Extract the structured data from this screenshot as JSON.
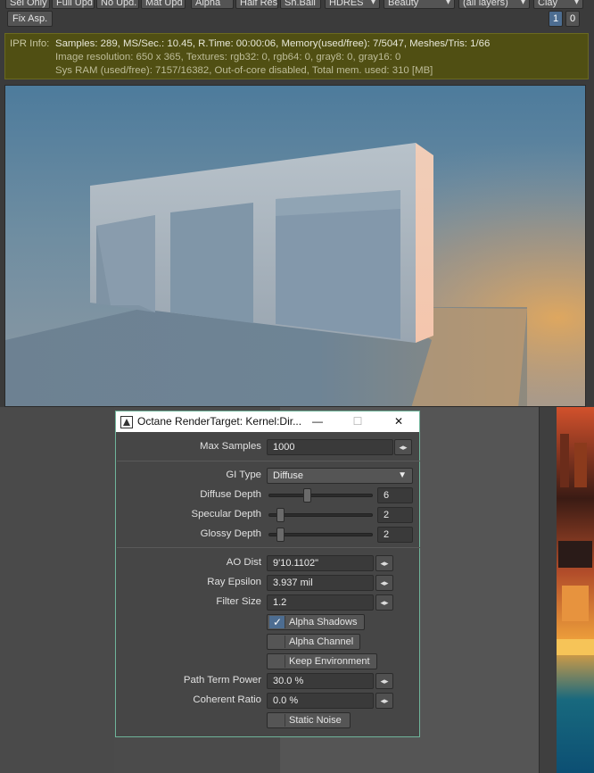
{
  "toolbar": {
    "buttons": [
      "Sel Only",
      "Full Upd.",
      "No Upd.",
      "Mat Upd",
      "Alpha",
      "Half Res",
      "Sh.Ball"
    ],
    "dropdowns": [
      "HDRES",
      "Beauty",
      "(all layers)",
      "Clay"
    ],
    "fix_aspect": "Fix Asp.",
    "num_one": "1",
    "num_zero": "0",
    "accent": "#4d6d91"
  },
  "ipr": {
    "label": "IPR Info:",
    "line1": "Samples: 289, MS/Sec.: 10.45, R.Time: 00:00:06, Memory(used/free): 7/5047, Meshes/Tris: 1/66",
    "line2": "Image resolution: 650 x 365, Textures:  rgb32: 0, rgb64: 0, gray8: 0, gray16: 0",
    "line3": "Sys RAM (used/free): 7157/16382, Out-of-core disabled, Total mem. used: 310  [MB]"
  },
  "dialog": {
    "title": "Octane RenderTarget: Kernel:Dir...",
    "minimize": "—",
    "maximize": "☐",
    "close": "✕",
    "max_samples": {
      "label": "Max Samples",
      "value": "1000"
    },
    "gi_type": {
      "label": "GI Type",
      "value": "Diffuse"
    },
    "diffuse_depth": {
      "label": "Diffuse Depth",
      "value": "6",
      "level": 0.37
    },
    "specular_depth": {
      "label": "Specular Depth",
      "value": "2",
      "level": 0.1
    },
    "glossy_depth": {
      "label": "Glossy Depth",
      "value": "2",
      "level": 0.1
    },
    "ao_dist": {
      "label": "AO Dist",
      "value": "9'10.1102\""
    },
    "ray_epsilon": {
      "label": "Ray Epsilon",
      "value": "3.937 mil"
    },
    "filter_size": {
      "label": "Filter Size",
      "value": "1.2"
    },
    "alpha_shadows": {
      "label": "Alpha Shadows",
      "checked": true
    },
    "alpha_channel": {
      "label": "Alpha Channel",
      "checked": false
    },
    "keep_environment": {
      "label": "Keep Environment",
      "checked": false
    },
    "path_term_power": {
      "label": "Path Term Power",
      "value": "30.0 %"
    },
    "coherent_ratio": {
      "label": "Coherent Ratio",
      "value": "0.0 %"
    },
    "static_noise": {
      "label": "Static Noise",
      "checked": false
    }
  }
}
